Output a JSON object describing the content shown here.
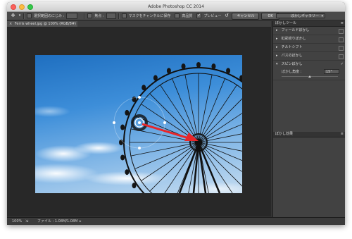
{
  "window": {
    "title": "Adobe Photoshop CC 2014"
  },
  "options_bar": {
    "feather_label": "選択範囲のにじみ :",
    "focus_label": "焦点 :",
    "save_mask_label": "マスクをチャンネルに保存",
    "high_quality_label": "高品質",
    "preview_label": "プレビュー",
    "cancel_label": "キャンセル",
    "ok_label": "OK",
    "gallery_label": "ぼかしギャラリー"
  },
  "document": {
    "tab_title": "Ferris wheel.jpg @ 100% (RGB/8#)"
  },
  "status": {
    "zoom": "100%",
    "file_info": "ファイル : 1.08M/1.08M"
  },
  "panel": {
    "title": "ぼかしツール",
    "items": [
      {
        "label": "フィールドぼかし",
        "expanded": false
      },
      {
        "label": "虹彩絞りぼかし",
        "expanded": false
      },
      {
        "label": "チルトシフト",
        "expanded": false
      },
      {
        "label": "パスのぼかし",
        "expanded": false
      },
      {
        "label": "スピンぼかし",
        "expanded": true
      }
    ],
    "spin": {
      "angle_label": "ぼかし角度 :",
      "angle_value": "15°"
    },
    "effects_title": "ぼかし効果"
  },
  "colors": {
    "accent_arrow": "#e8262a",
    "sky_top": "#1f6fc0",
    "sky_bottom": "#c5dcf0"
  }
}
